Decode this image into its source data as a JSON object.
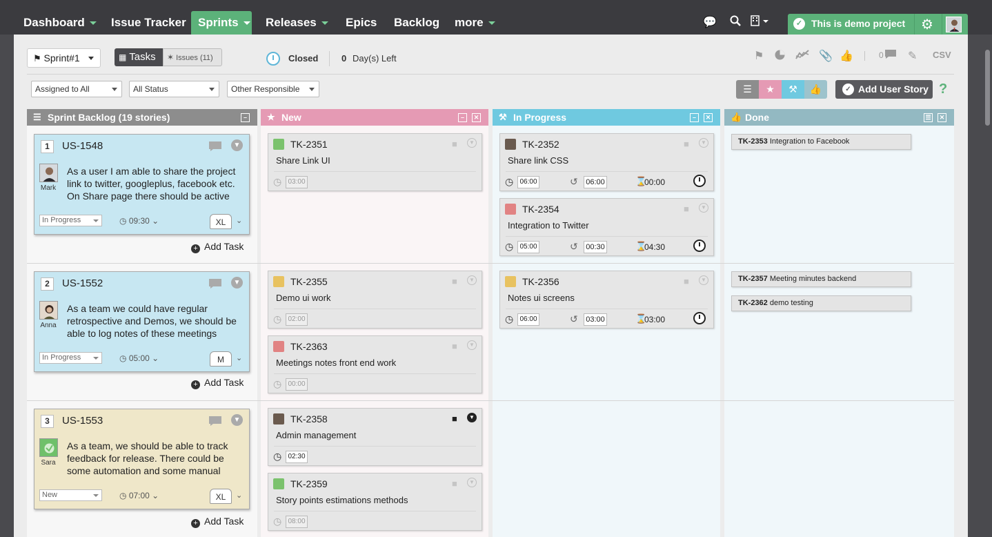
{
  "nav": {
    "items": [
      {
        "label": "Dashboard",
        "caret": true
      },
      {
        "label": "Issue Tracker",
        "caret": false
      },
      {
        "label": "Sprints",
        "caret": true
      },
      {
        "label": "Releases",
        "caret": true
      },
      {
        "label": "Epics",
        "caret": false
      },
      {
        "label": "Backlog",
        "caret": false
      },
      {
        "label": "more",
        "caret": true
      }
    ],
    "active": "Sprints",
    "project_label": "This is demo project",
    "icons": [
      "chat-icon",
      "search-icon",
      "building-icon",
      "gear-icon",
      "avatar"
    ]
  },
  "toolbar": {
    "sprint": "Sprint#1",
    "tasks_label": "Tasks",
    "issues_label": "Issues (11)",
    "status": "Closed",
    "days_count": "0",
    "days_label": "Day(s) Left",
    "icons": [
      "runner-icon",
      "pie-chart-icon",
      "trend-icon",
      "paperclip-icon",
      "thumbs-up-icon",
      "comment-icon",
      "pencil-icon",
      "csv-icon"
    ],
    "comment_count": "0",
    "csv_label": "CSV"
  },
  "filters": {
    "assigned": "Assigned to All",
    "status": "All Status",
    "responsible": "Other Responsible",
    "add_story": "Add User Story",
    "help": "?"
  },
  "columns": [
    {
      "title": "Sprint Backlog (19 stories)",
      "color": "#8d8d8d"
    },
    {
      "title": "New",
      "color": "#e59ab4"
    },
    {
      "title": "In Progress",
      "color": "#6fc9e0"
    },
    {
      "title": "Done",
      "color": "#93b9c2"
    }
  ],
  "stories": [
    {
      "num": "1",
      "id": "US-1548",
      "avatar_name": "Mark",
      "text": "As a user I am able to share the project link to twitter, googleplus, facebook etc. On Share page there should be active",
      "status": "In Progress",
      "time": "09:30",
      "size": "XL",
      "color": "blue"
    },
    {
      "num": "2",
      "id": "US-1552",
      "avatar_name": "Anna",
      "text": "As a team we could have regular retrospective and Demos, we should be able to log notes of these meetings",
      "status": "In Progress",
      "time": "05:00",
      "size": "M",
      "color": "blue"
    },
    {
      "num": "3",
      "id": "US-1553",
      "avatar_name": "Sara",
      "text": "As a team, we should be able to track feedback for release. There could be some automation and some manual",
      "status": "New",
      "time": "07:00",
      "size": "XL",
      "color": "tan"
    }
  ],
  "add_task_label": "Add Task",
  "new_tasks": [
    {
      "id": "TK-2351",
      "title": "Share Link UI",
      "estimate": "03:00"
    },
    {
      "id": "TK-2355",
      "title": "Demo ui work",
      "estimate": "02:00"
    },
    {
      "id": "TK-2363",
      "title": "Meetings notes front end work",
      "estimate": "00:00"
    },
    {
      "id": "TK-2358",
      "title": "Admin management",
      "estimate": "02:30"
    },
    {
      "id": "TK-2359",
      "title": "Story points estimations methods",
      "estimate": "08:00"
    }
  ],
  "progress_tasks": [
    {
      "id": "TK-2352",
      "title": "Share link CSS",
      "estimate": "06:00",
      "spent": "06:00",
      "remaining": "00:00"
    },
    {
      "id": "TK-2354",
      "title": "Integration to Twitter",
      "estimate": "05:00",
      "spent": "00:30",
      "remaining": "04:30"
    },
    {
      "id": "TK-2356",
      "title": "Notes ui screens",
      "estimate": "06:00",
      "spent": "03:00",
      "remaining": "03:00"
    }
  ],
  "done_tasks": [
    {
      "id": "TK-2353",
      "title": "Integration to Facebook"
    },
    {
      "id": "TK-2357",
      "title": "Meeting minutes backend"
    },
    {
      "id": "TK-2362",
      "title": "demo testing"
    }
  ]
}
